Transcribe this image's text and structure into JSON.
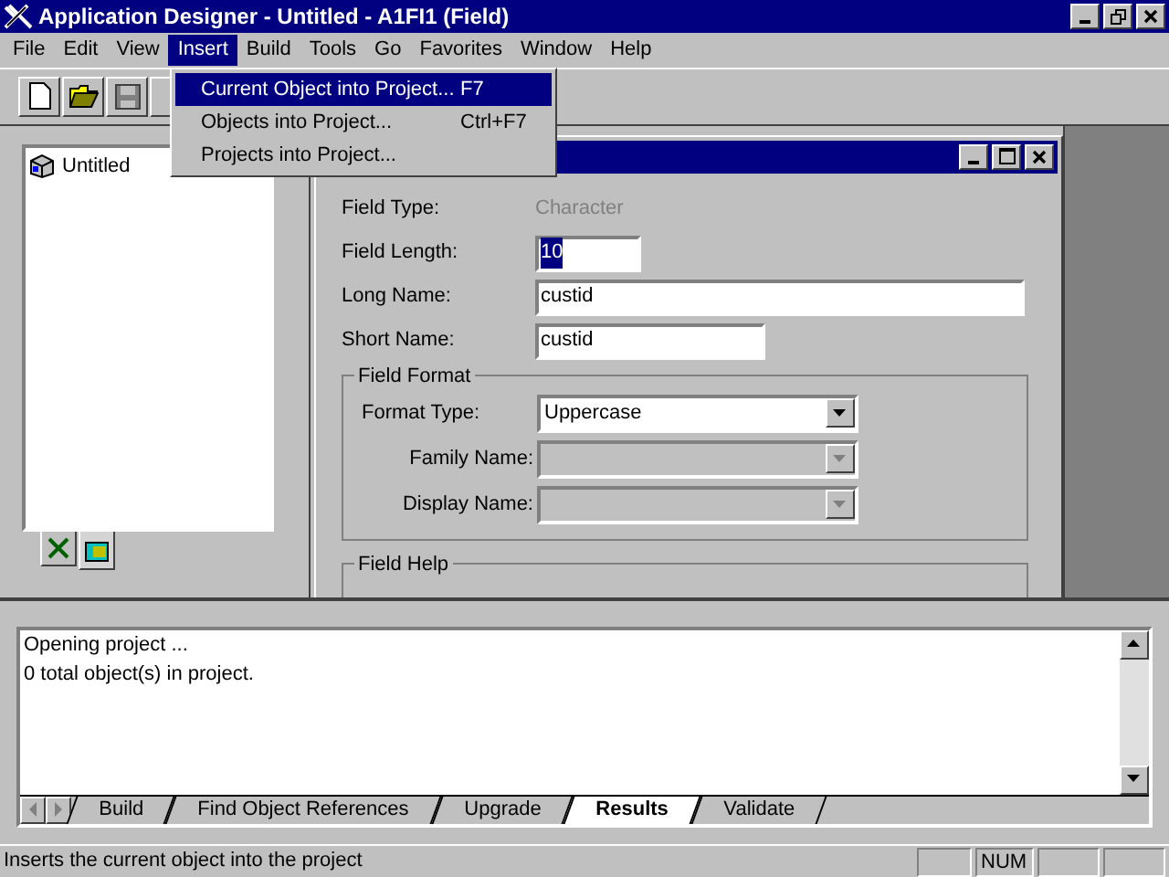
{
  "window": {
    "title": "Application Designer - Untitled - A1FI1 (Field)"
  },
  "menu": [
    {
      "label": "File",
      "selected": false
    },
    {
      "label": "Edit",
      "selected": false
    },
    {
      "label": "View",
      "selected": false
    },
    {
      "label": "Insert",
      "selected": true
    },
    {
      "label": "Build",
      "selected": false
    },
    {
      "label": "Tools",
      "selected": false
    },
    {
      "label": "Go",
      "selected": false
    },
    {
      "label": "Favorites",
      "selected": false
    },
    {
      "label": "Window",
      "selected": false
    },
    {
      "label": "Help",
      "selected": false
    }
  ],
  "dropdown": [
    {
      "label": "Current Object into Project...",
      "shortcut": "F7",
      "selected": true
    },
    {
      "label": "Objects into Project...",
      "shortcut": "Ctrl+F7",
      "selected": false
    },
    {
      "label": "Projects into Project...",
      "selected": false
    }
  ],
  "project_tree": {
    "items": [
      {
        "label": "Untitled"
      }
    ]
  },
  "left_tabs": [
    {
      "kind": "development",
      "selected": false
    },
    {
      "kind": "project",
      "selected": true
    }
  ],
  "form": {
    "field_type": {
      "label": "Field Type:",
      "value": "Character"
    },
    "field_length": {
      "label": "Field Length:",
      "value": "10",
      "highlighted": true
    },
    "long_name": {
      "label": "Long Name:",
      "value": "custid"
    },
    "short_name": {
      "label": "Short Name:",
      "value": "custid"
    },
    "field_format": {
      "legend": "Field Format",
      "rows": [
        {
          "label": "Format Type:",
          "value": "Uppercase",
          "disabled": false
        },
        {
          "label": "Family Name:",
          "disabled": true
        },
        {
          "label": "Display Name:",
          "disabled": true
        }
      ]
    },
    "field_help": {
      "legend": "Field Help"
    }
  },
  "output": {
    "lines": [
      "Opening project ...",
      "0  total object(s) in project."
    ],
    "tabs": [
      {
        "label": "Build",
        "selected": false
      },
      {
        "label": "Find Object References",
        "selected": false
      },
      {
        "label": "Upgrade",
        "selected": false
      },
      {
        "label": "Results",
        "selected": true
      },
      {
        "label": "Validate",
        "selected": false
      }
    ]
  },
  "status_bar": {
    "message": "Inserts the current object into the project",
    "num_indicator": "NUM"
  }
}
